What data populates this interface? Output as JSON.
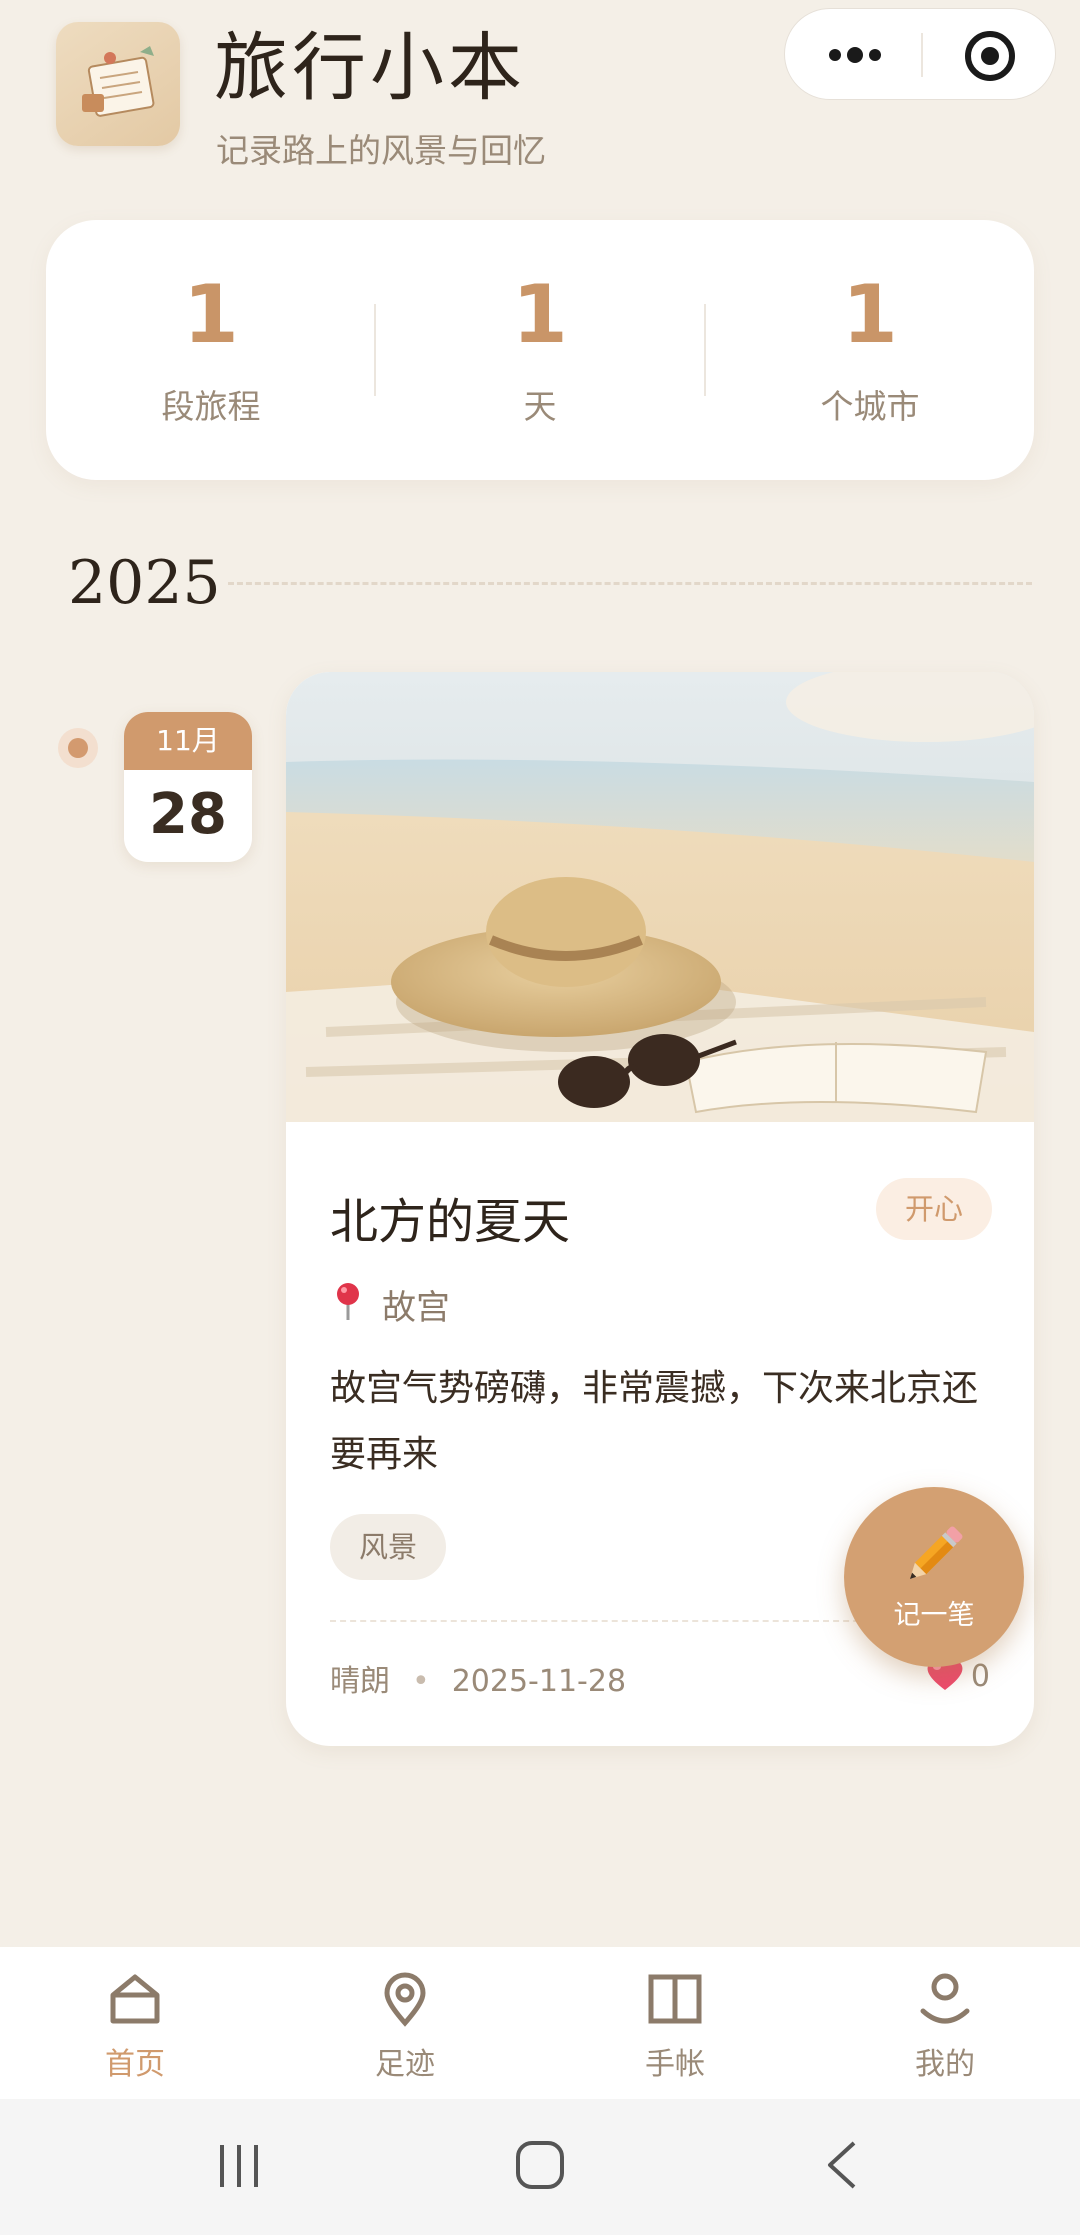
{
  "header": {
    "title": "旅行小本",
    "subtitle": "记录路上的风景与回忆",
    "logo_icon": "travel-journal-icon"
  },
  "capsule": {
    "more_icon": "more-dots-icon",
    "close_icon": "target-icon"
  },
  "stats": [
    {
      "value": "1",
      "label": "段旅程"
    },
    {
      "value": "1",
      "label": "天"
    },
    {
      "value": "1",
      "label": "个城市"
    }
  ],
  "year": "2025",
  "entry": {
    "month": "11月",
    "day": "28",
    "title": "北方的夏天",
    "mood": "开心",
    "location": "故宫",
    "body": "故宫气势磅礴，非常震撼，下次来北京还要再来",
    "tag": "风景",
    "weather": "晴朗",
    "dot": "•",
    "date": "2025-11-28",
    "likes": "0",
    "image_icon": "beach-straw-hat-image"
  },
  "fab": {
    "label": "记一笔",
    "icon": "pencil-icon"
  },
  "tabs": [
    {
      "label": "首页",
      "icon": "home-icon",
      "active": true
    },
    {
      "label": "足迹",
      "icon": "location-icon",
      "active": false
    },
    {
      "label": "手帐",
      "icon": "book-icon",
      "active": false
    },
    {
      "label": "我的",
      "icon": "profile-icon",
      "active": false
    }
  ],
  "colors": {
    "background": "#f4efe7",
    "accent": "#d09a6d",
    "stat_number": "#c99568",
    "text_muted": "#9a8a78"
  }
}
